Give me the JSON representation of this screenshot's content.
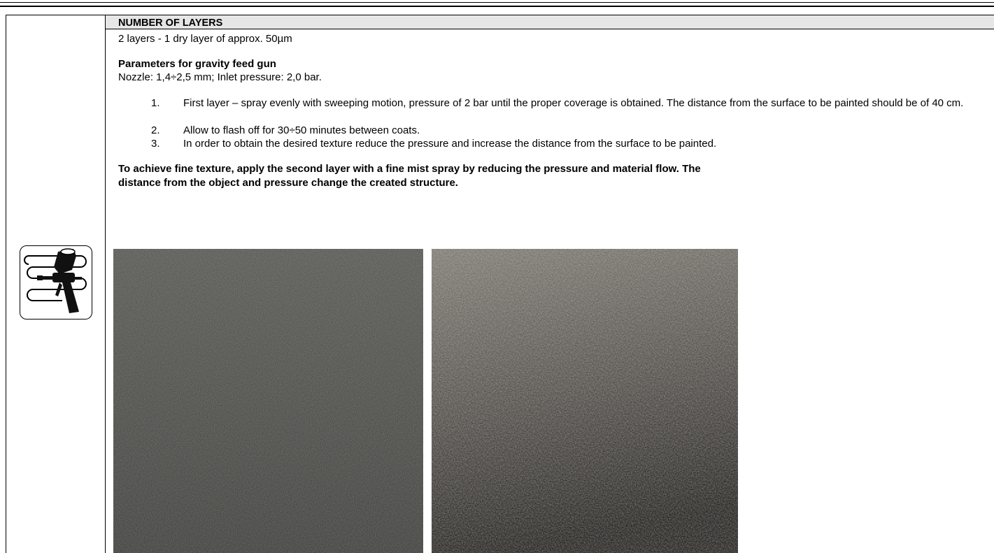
{
  "header": {
    "title": "NUMBER OF LAYERS"
  },
  "layers_line": "2 layers - 1 dry layer of approx. 50µm",
  "parameters": {
    "heading": "Parameters for gravity feed gun",
    "detail": "Nozzle: 1,4÷2,5 mm;  Inlet pressure: 2,0 bar."
  },
  "steps": [
    {
      "number": "1.",
      "text": "First layer – spray evenly with sweeping motion, pressure of 2 bar until the proper coverage is obtained. The distance from the surface to be painted should be of 40 cm."
    },
    {
      "number": "2.",
      "text": "Allow to flash off  for 30÷50 minutes between coats."
    },
    {
      "number": "3.",
      "text": "In order to obtain the desired texture reduce the pressure and increase the distance from the surface to be painted."
    }
  ],
  "fine_texture_note": {
    "line1": "To achieve fine texture, apply the second layer with a fine mist spray by reducing the pressure and material flow.  The",
    "line2": "distance from the object and pressure change the created structure."
  },
  "icon": {
    "name": "spray-gun-icon"
  },
  "photos": [
    {
      "name": "texture-sample-dark",
      "base_color": "#3a3a38"
    },
    {
      "name": "texture-sample-light",
      "base_color": "#5a5650"
    }
  ]
}
